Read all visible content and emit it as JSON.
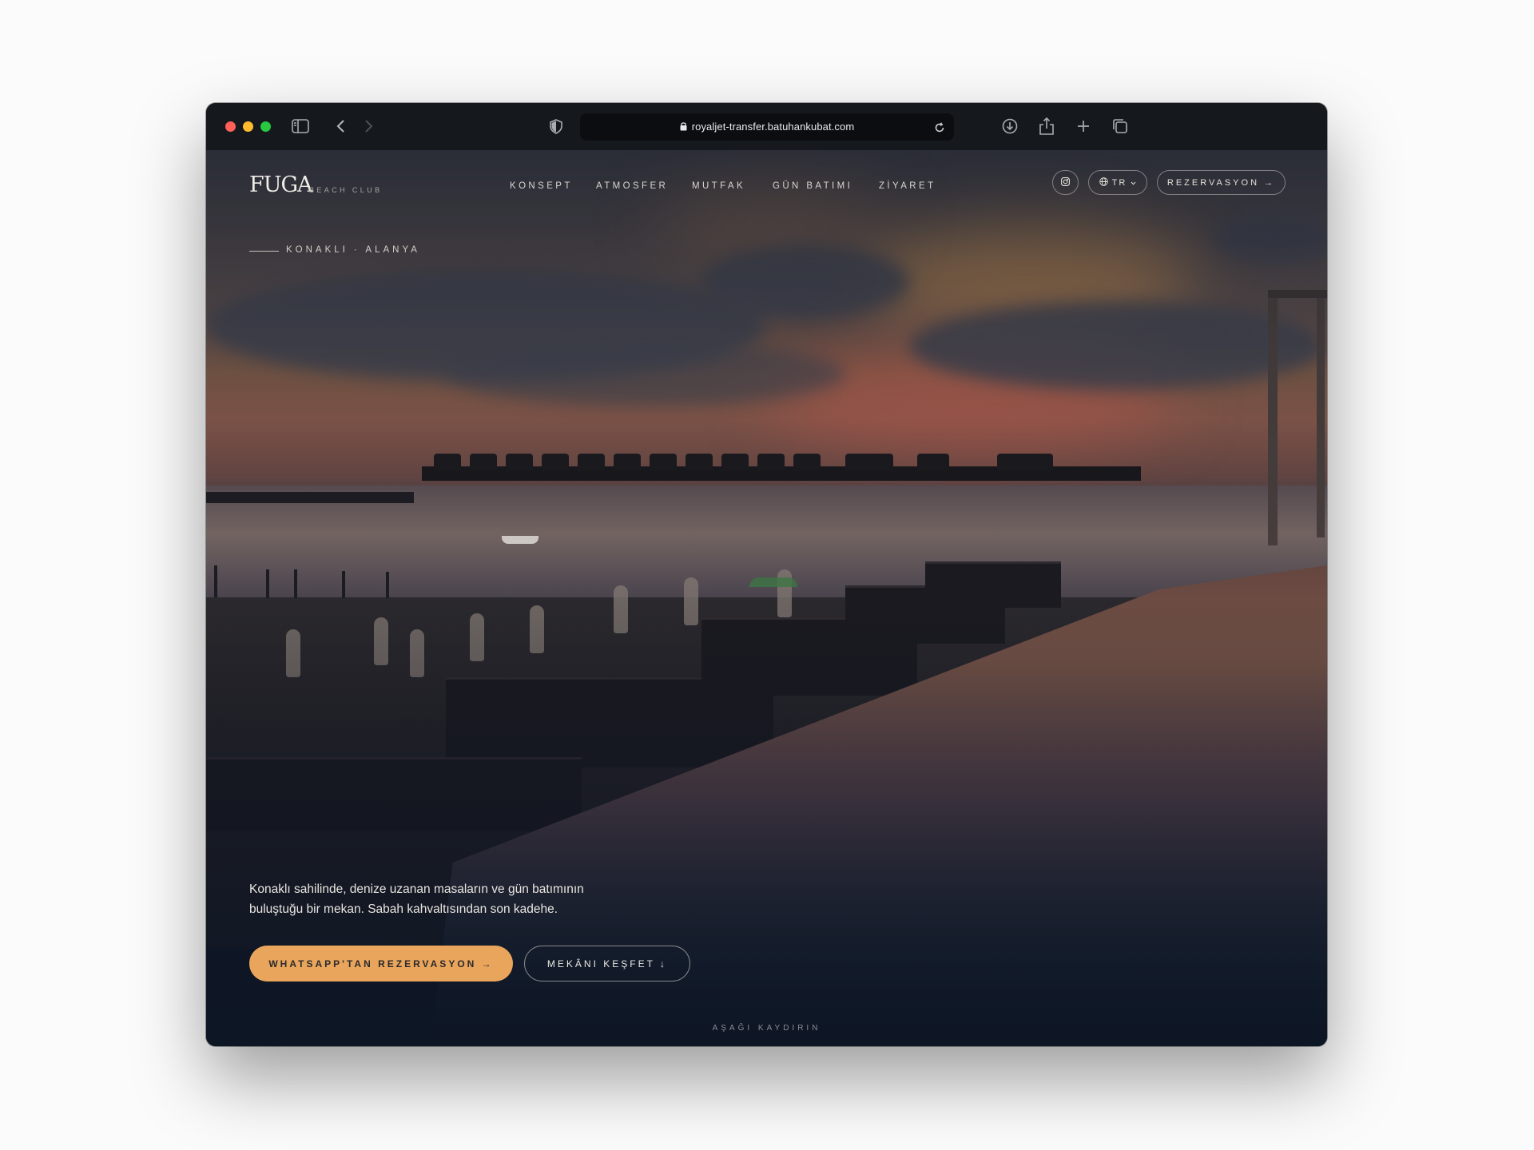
{
  "browser": {
    "url": "royaljet-transfer.batuhankubat.com"
  },
  "site": {
    "logo": "FUGA",
    "logo_sub": "BEACH CLUB",
    "nav": [
      "KONSEPT",
      "ATMOSFER",
      "MUTFAK",
      "GÜN BATIMI",
      "ZİYARET"
    ],
    "lang": "TR",
    "reserve": "REZERVASYON →"
  },
  "hero": {
    "eyebrow": "KONAKLI · ALANYA",
    "lead_line1": "Konaklı sahilinde, denize uzanan masaların ve gün batımının",
    "lead_line2": "buluştuğu bir mekan. Sabah kahvaltısından son kadehe.",
    "cta_primary": "WHATSAPP'TAN REZERVASYON →",
    "cta_secondary": "MEKÂNI KEŞFET ↓",
    "scroll_hint": "AŞAĞI KAYDIRIN"
  },
  "colors": {
    "accent": "#e9a55b",
    "toolbar": "#15191d",
    "hero_bottom": "#0e1625"
  },
  "icons": [
    "sidebar-icon",
    "back-icon",
    "forward-icon",
    "shield-icon",
    "lock-icon",
    "reload-icon",
    "download-icon",
    "share-icon",
    "new-tab-icon",
    "tabs-overview-icon",
    "instagram-icon",
    "globe-icon",
    "chevron-down-icon"
  ]
}
